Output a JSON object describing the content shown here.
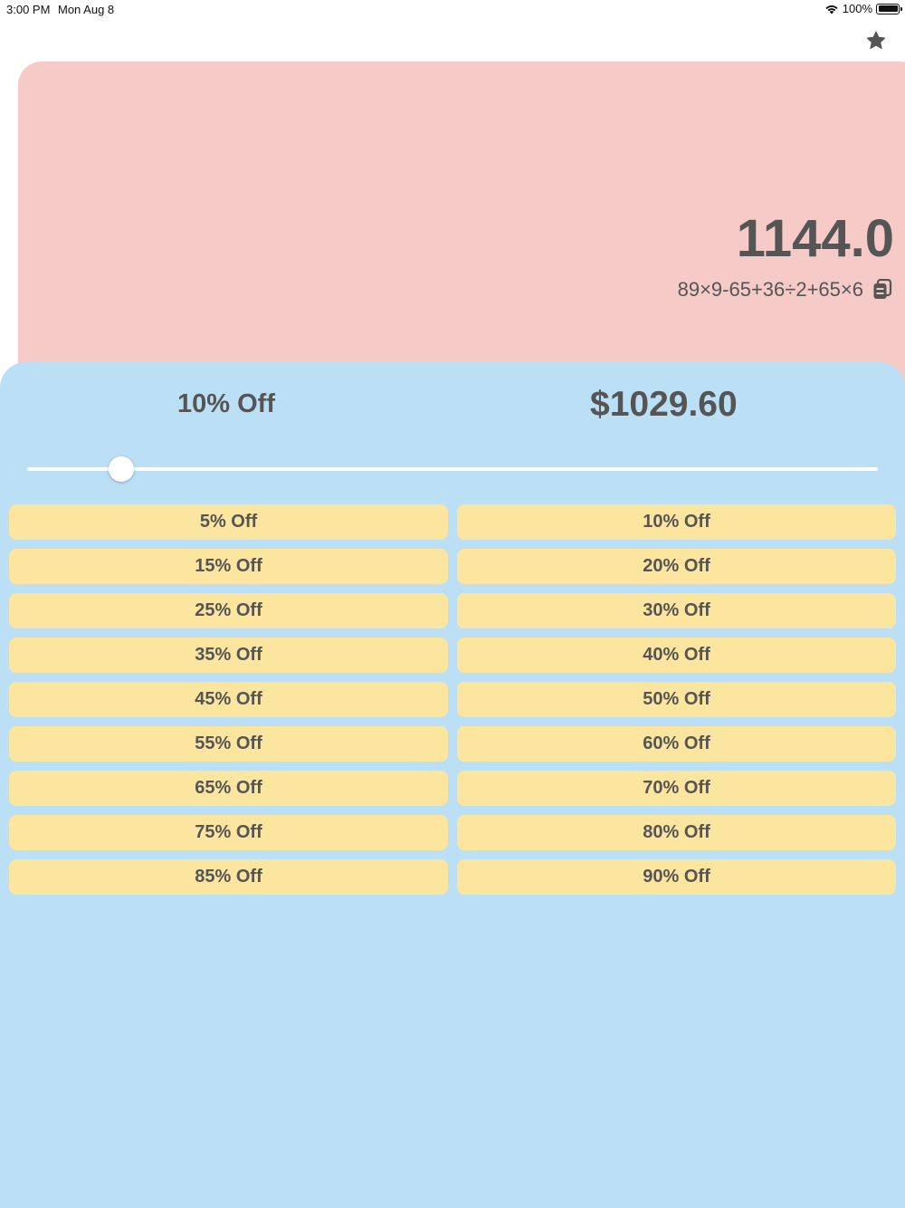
{
  "status_bar": {
    "time": "3:00 PM",
    "date": "Mon Aug 8",
    "battery_percent": "100%",
    "battery_level": 1.0
  },
  "toolbar": {
    "favorite_icon": "star-icon"
  },
  "calculator": {
    "result": "1144.0",
    "expression": "89×9-65+36÷2+65×6",
    "copy_icon": "copy-icon",
    "background_color": "#f5cac7"
  },
  "discount": {
    "label": "10% Off",
    "price": "$1029.60",
    "slider_value_percent": 10,
    "slider_max_percent": 90,
    "background_color": "#bbdff5",
    "presets": [
      "5% Off",
      "10% Off",
      "15% Off",
      "20% Off",
      "25% Off",
      "30% Off",
      "35% Off",
      "40% Off",
      "45% Off",
      "50% Off",
      "55% Off",
      "60% Off",
      "65% Off",
      "70% Off",
      "75% Off",
      "80% Off",
      "85% Off",
      "90% Off"
    ],
    "preset_color": "#fce59f"
  }
}
